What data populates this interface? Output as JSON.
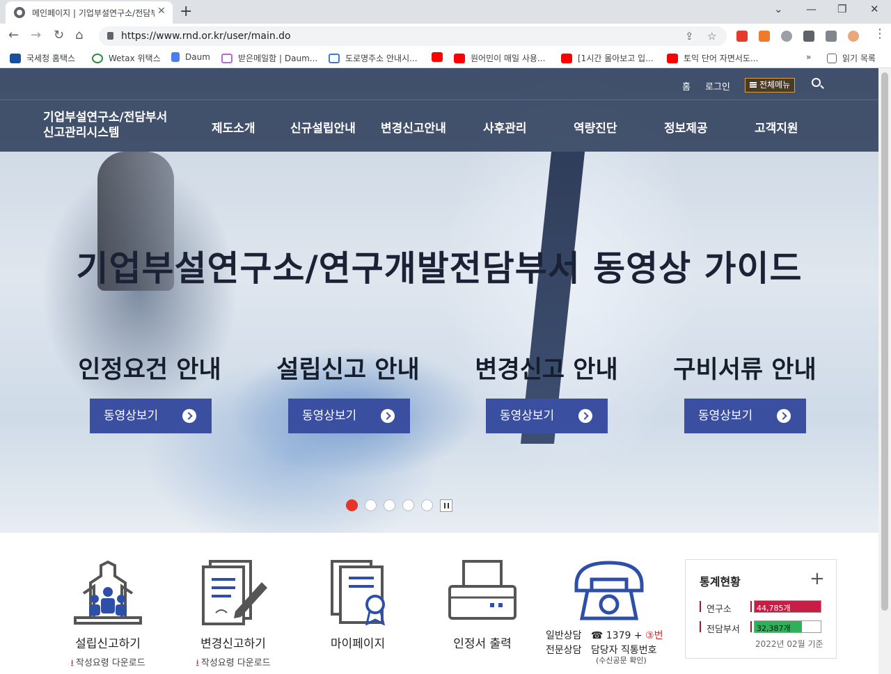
{
  "browser": {
    "tab_title": "메인페이지 | 기업부설연구소/전담부서",
    "url": "https://www.rnd.or.kr/user/main.do",
    "bookmarks": [
      {
        "label": "국세청 홈택스",
        "icon": "hometax-icon",
        "color": "#1a4f9c"
      },
      {
        "label": "Wetax 위택스",
        "icon": "wetax-icon",
        "color": "#2a8f3a"
      },
      {
        "label": "Daum",
        "icon": "daum-icon",
        "color": "#ffffff"
      },
      {
        "label": "받은메일함 | Daum...",
        "icon": "mail-icon",
        "color": "#ffffff"
      },
      {
        "label": "도로명주소 안내시...",
        "icon": "juso-icon",
        "color": "#ffffff"
      },
      {
        "label": "",
        "icon": "youtube-icon",
        "color": "#ff0000"
      },
      {
        "label": "원어민이 매일 사용...",
        "icon": "youtube-icon",
        "color": "#ff0000"
      },
      {
        "label": "[1시간 몰아보고 입...",
        "icon": "youtube-icon",
        "color": "#ff0000"
      },
      {
        "label": "토익 단어 자면서도...",
        "icon": "youtube-icon",
        "color": "#ff0000"
      }
    ],
    "more_label": "»",
    "reading_list": "읽기 목록"
  },
  "site": {
    "top_links": {
      "home": "홈",
      "login": "로그인",
      "all_menu": "전체메뉴"
    },
    "logo_line1": "기업부설연구소/전담부서",
    "logo_line2": "신고관리시스템",
    "gnb": [
      "제도소개",
      "신규설립안내",
      "변경신고안내",
      "사후관리",
      "역량진단",
      "정보제공",
      "고객지원"
    ]
  },
  "hero": {
    "headline": "기업부설연구소/연구개발전담부서 동영상 가이드",
    "guides": [
      {
        "title": "인정요건 안내",
        "button": "동영상보기"
      },
      {
        "title": "설립신고 안내",
        "button": "동영상보기"
      },
      {
        "title": "변경신고 안내",
        "button": "동영상보기"
      },
      {
        "title": "구비서류 안내",
        "button": "동영상보기"
      }
    ],
    "slide_count": 5,
    "active_slide": 1
  },
  "quick": [
    {
      "label": "설립신고하기",
      "sub": "작성요령 다운로드",
      "icon": "building-icon"
    },
    {
      "label": "변경신고하기",
      "sub": "작성요령 다운로드",
      "icon": "document-pen-icon"
    },
    {
      "label": "마이페이지",
      "sub": "",
      "icon": "certificate-icon"
    },
    {
      "label": "인정서 출력",
      "sub": "",
      "icon": "printer-icon"
    }
  ],
  "consult": {
    "line1_a": "일반상담",
    "line1_b": "☎ 1379 + ",
    "line1_c": "③번",
    "line2_a": "전문상담",
    "line2_b": "담당자 직통번호",
    "note": "(수신공문 확인)",
    "icon": "telephone-icon"
  },
  "stats": {
    "title": "통계현황",
    "plus": "+",
    "rows": [
      {
        "label": "연구소",
        "value": "44,785개",
        "ratio": 1.0,
        "color": "#c81e45"
      },
      {
        "label": "전담부서",
        "value": "32,387개",
        "ratio": 0.72,
        "color": "#2fb15a"
      }
    ],
    "basis": "2022년 02월 기준"
  }
}
